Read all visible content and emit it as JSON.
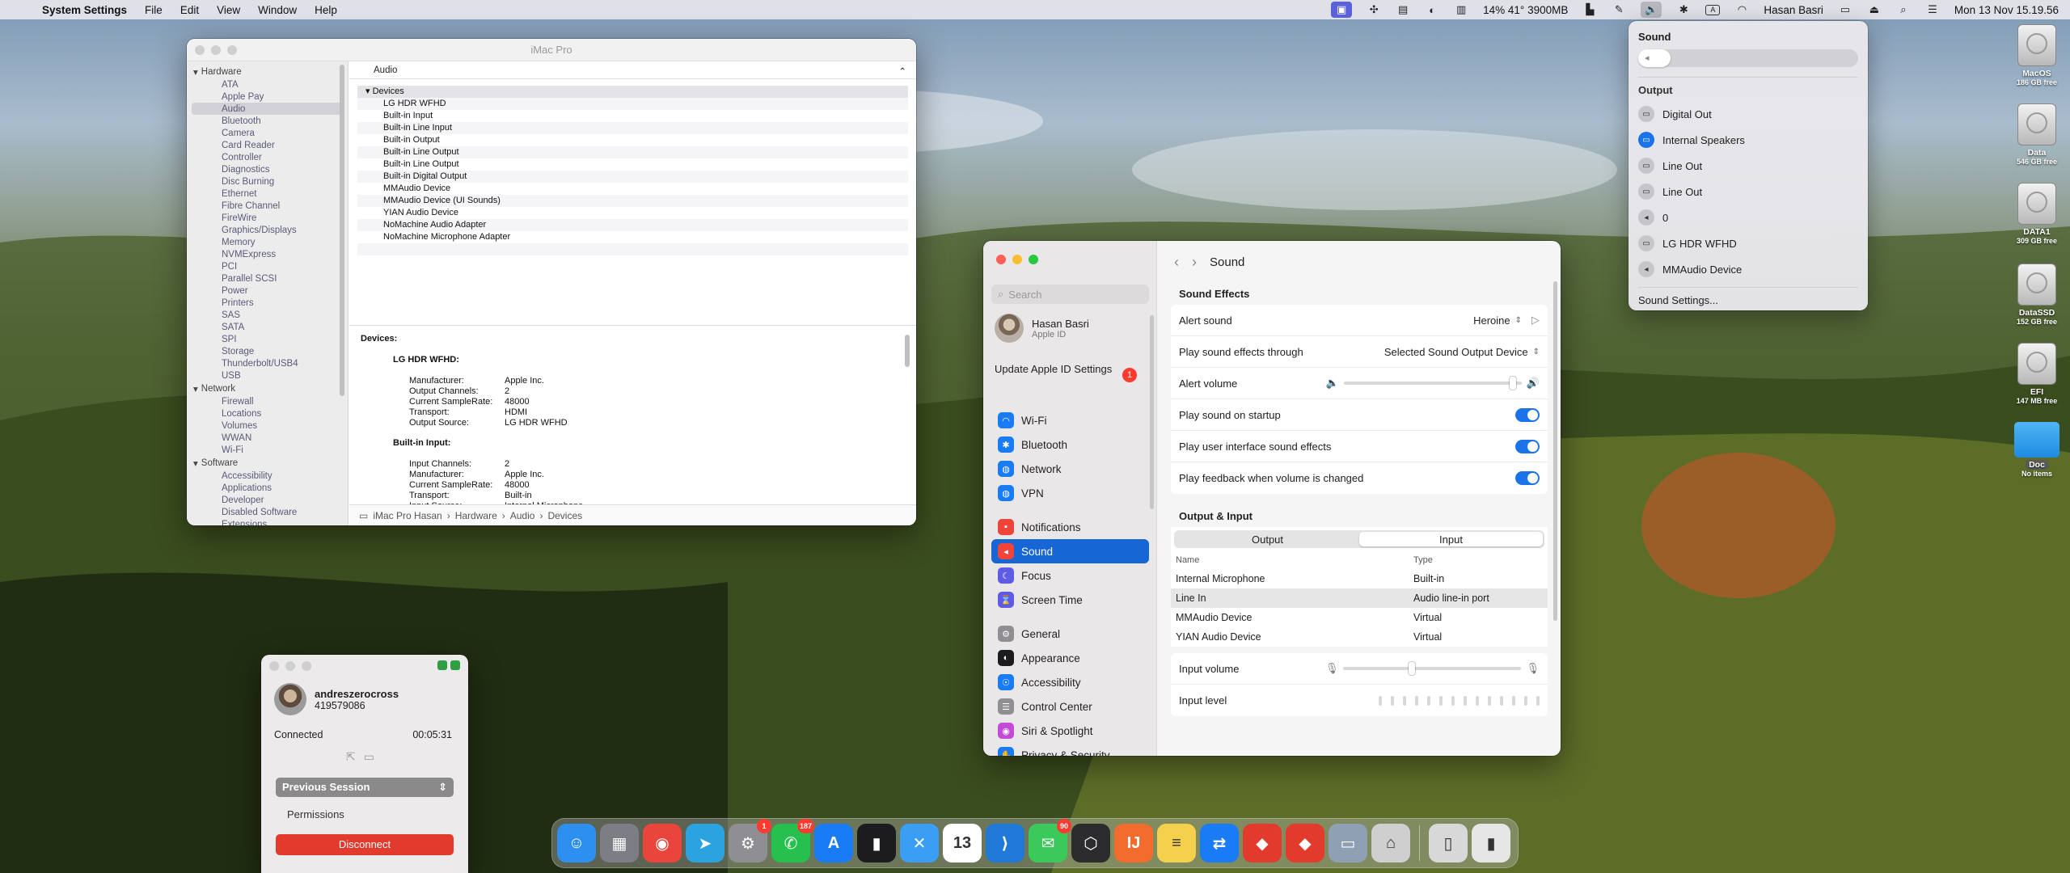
{
  "menubar": {
    "app_name": "System Settings",
    "menus": [
      "File",
      "Edit",
      "View",
      "Window",
      "Help"
    ],
    "stats": "14% 41° 3900MB",
    "user": "Hasan Basri",
    "clock": "Mon 13 Nov  15.19.56"
  },
  "sysinfo": {
    "title": "iMac Pro",
    "sidebar": [
      {
        "group": "Hardware",
        "items": [
          "ATA",
          "Apple Pay",
          "Audio",
          "Bluetooth",
          "Camera",
          "Card Reader",
          "Controller",
          "Diagnostics",
          "Disc Burning",
          "Ethernet",
          "Fibre Channel",
          "FireWire",
          "Graphics/Displays",
          "Memory",
          "NVMExpress",
          "PCI",
          "Parallel SCSI",
          "Power",
          "Printers",
          "SAS",
          "SATA",
          "SPI",
          "Storage",
          "Thunderbolt/USB4",
          "USB"
        ]
      },
      {
        "group": "Network",
        "items": [
          "Firewall",
          "Locations",
          "Volumes",
          "WWAN",
          "Wi-Fi"
        ]
      },
      {
        "group": "Software",
        "items": [
          "Accessibility",
          "Applications",
          "Developer",
          "Disabled Software",
          "Extensions"
        ]
      }
    ],
    "selected": "Audio",
    "header": "Audio",
    "devices_label": "Devices",
    "devices": [
      "LG HDR WFHD",
      "Built-in Input",
      "Built-in Line Input",
      "Built-in Output",
      "Built-in Line Output",
      "Built-in Line Output",
      "Built-in Digital Output",
      "MMAudio Device",
      "MMAudio Device (UI Sounds)",
      "YIAN Audio Device",
      "NoMachine Audio Adapter",
      "NoMachine Microphone Adapter"
    ],
    "detail": {
      "title": "Devices:",
      "sections": [
        {
          "name": "LG HDR WFHD:",
          "rows": [
            [
              "Manufacturer:",
              "Apple Inc."
            ],
            [
              "Output Channels:",
              "2"
            ],
            [
              "Current SampleRate:",
              "48000"
            ],
            [
              "Transport:",
              "HDMI"
            ],
            [
              "Output Source:",
              "LG HDR WFHD"
            ]
          ]
        },
        {
          "name": "Built-in Input:",
          "rows": [
            [
              "Input Channels:",
              "2"
            ],
            [
              "Manufacturer:",
              "Apple Inc."
            ],
            [
              "Current SampleRate:",
              "48000"
            ],
            [
              "Transport:",
              "Built-in"
            ],
            [
              "Input Source:",
              "Internal Microphone"
            ]
          ]
        }
      ]
    },
    "path": [
      "iMac Pro Hasan",
      "Hardware",
      "Audio",
      "Devices"
    ]
  },
  "settings": {
    "search_placeholder": "Search",
    "user_name": "Hasan Basri",
    "user_sub": "Apple ID",
    "update_text": "Update Apple ID Settings",
    "update_badge": "1",
    "sidebar_groups": [
      [
        {
          "label": "Wi-Fi",
          "color": "#1a7cf5",
          "icon": "wifi-icon"
        },
        {
          "label": "Bluetooth",
          "color": "#1a7cf5",
          "icon": "bluetooth-icon"
        },
        {
          "label": "Network",
          "color": "#1a7cf5",
          "icon": "globe-icon"
        },
        {
          "label": "VPN",
          "color": "#1a7cf5",
          "icon": "vpn-icon"
        }
      ],
      [
        {
          "label": "Notifications",
          "color": "#f0443a",
          "icon": "bell-icon"
        },
        {
          "label": "Sound",
          "color": "#f0443a",
          "icon": "speaker-icon",
          "active": true
        },
        {
          "label": "Focus",
          "color": "#5e5ce6",
          "icon": "moon-icon"
        },
        {
          "label": "Screen Time",
          "color": "#5e5ce6",
          "icon": "hourglass-icon"
        }
      ],
      [
        {
          "label": "General",
          "color": "#8e8e93",
          "icon": "gear-icon"
        },
        {
          "label": "Appearance",
          "color": "#1c1c1e",
          "icon": "appearance-icon"
        },
        {
          "label": "Accessibility",
          "color": "#1a7cf5",
          "icon": "accessibility-icon"
        },
        {
          "label": "Control Center",
          "color": "#8e8e93",
          "icon": "control-center-icon"
        },
        {
          "label": "Siri & Spotlight",
          "color": "#c24ad6",
          "icon": "siri-icon"
        },
        {
          "label": "Privacy & Security",
          "color": "#1a7cf5",
          "icon": "hand-icon"
        }
      ]
    ],
    "page_title": "Sound",
    "sound_effects_title": "Sound Effects",
    "alert_sound_label": "Alert sound",
    "alert_sound_value": "Heroine",
    "play_through_label": "Play sound effects through",
    "play_through_value": "Selected Sound Output Device",
    "alert_volume_label": "Alert volume",
    "alert_volume_level": 0.97,
    "startup_label": "Play sound on startup",
    "ui_sounds_label": "Play user interface sound effects",
    "feedback_label": "Play feedback when volume is changed",
    "output_input_title": "Output & Input",
    "tab_output": "Output",
    "tab_input": "Input",
    "col_name": "Name",
    "col_type": "Type",
    "input_devices": [
      {
        "name": "Internal Microphone",
        "type": "Built-in"
      },
      {
        "name": "Line In",
        "type": "Audio line-in port",
        "selected": true
      },
      {
        "name": "MMAudio Device",
        "type": "Virtual"
      },
      {
        "name": "YIAN Audio Device",
        "type": "Virtual"
      }
    ],
    "input_volume_label": "Input volume",
    "input_volume_level": 0.38,
    "input_level_label": "Input level"
  },
  "sound_menu": {
    "title": "Sound",
    "volume_level": 0.12,
    "output_label": "Output",
    "outputs": [
      {
        "label": "Digital Out",
        "icon": "display-icon"
      },
      {
        "label": "Internal Speakers",
        "icon": "display-icon",
        "active": true
      },
      {
        "label": "Line Out",
        "icon": "display-icon"
      },
      {
        "label": "Line Out",
        "icon": "display-icon"
      },
      {
        "label": "0",
        "icon": "speaker-icon"
      },
      {
        "label": "LG HDR WFHD",
        "icon": "display-icon"
      },
      {
        "label": "MMAudio Device",
        "icon": "speaker-icon"
      }
    ],
    "settings_link": "Sound Settings..."
  },
  "desktop": [
    {
      "name": "MacOS",
      "sub": "186 GB free",
      "kind": "disk"
    },
    {
      "name": "Data",
      "sub": "546 GB free",
      "kind": "disk"
    },
    {
      "name": "DATA1",
      "sub": "309 GB free",
      "kind": "disk"
    },
    {
      "name": "DataSSD",
      "sub": "152 GB free",
      "kind": "disk"
    },
    {
      "name": "EFI",
      "sub": "147 MB free",
      "kind": "disk"
    },
    {
      "name": "Doc",
      "sub": "No items",
      "kind": "folder"
    }
  ],
  "remote": {
    "user": "andreszerocross",
    "id": "419579086",
    "status": "Connected",
    "timer": "00:05:31",
    "session_select": "Previous Session",
    "permissions": "Permissions",
    "disconnect": "Disconnect"
  },
  "dock": {
    "apps": [
      {
        "name": "Finder",
        "color": "#2d8ff0",
        "glyph": "☺"
      },
      {
        "name": "Launchpad",
        "color": "#7d7d85",
        "glyph": "▦"
      },
      {
        "name": "Chrome",
        "color": "#e9453a",
        "glyph": "◉"
      },
      {
        "name": "Telegram",
        "color": "#2aa3e0",
        "glyph": "➤"
      },
      {
        "name": "System Settings",
        "color": "#8e8e93",
        "glyph": "⚙",
        "badge": "1"
      },
      {
        "name": "WhatsApp",
        "color": "#25c04d",
        "glyph": "✆",
        "badge": "187"
      },
      {
        "name": "App Store",
        "color": "#1a7cf5",
        "glyph": "A"
      },
      {
        "name": "Terminal",
        "color": "#1c1c1e",
        "glyph": "▮"
      },
      {
        "name": "Xcode",
        "color": "#3a9ef5",
        "glyph": "✕"
      },
      {
        "name": "Calendar",
        "color": "#ffffff",
        "glyph": "13"
      },
      {
        "name": "VS Code",
        "color": "#1e7ad6",
        "glyph": "⟩"
      },
      {
        "name": "Messages",
        "color": "#3cc95b",
        "glyph": "✉",
        "badge": "90"
      },
      {
        "name": "OpenAI",
        "color": "#2c2c2e",
        "glyph": "⬡"
      },
      {
        "name": "IntelliJ",
        "color": "#f26c2e",
        "glyph": "IJ"
      },
      {
        "name": "Notes",
        "color": "#f5d04c",
        "glyph": "≡"
      },
      {
        "name": "Remote",
        "color": "#1a7cf5",
        "glyph": "⇄"
      },
      {
        "name": "AnyDesk",
        "color": "#e23a2c",
        "glyph": "◆"
      },
      {
        "name": "AnyDesk 2",
        "color": "#e23a2c",
        "glyph": "◆"
      },
      {
        "name": "Network Utility",
        "color": "#8fa0b4",
        "glyph": "▭"
      },
      {
        "name": "Migration",
        "color": "#cfcfcf",
        "glyph": "⌂"
      }
    ],
    "trailing": [
      {
        "name": "Downloads",
        "color": "#d8d8d8",
        "glyph": "▯"
      },
      {
        "name": "Trash",
        "color": "#e6e6e6",
        "glyph": "▮"
      }
    ]
  }
}
